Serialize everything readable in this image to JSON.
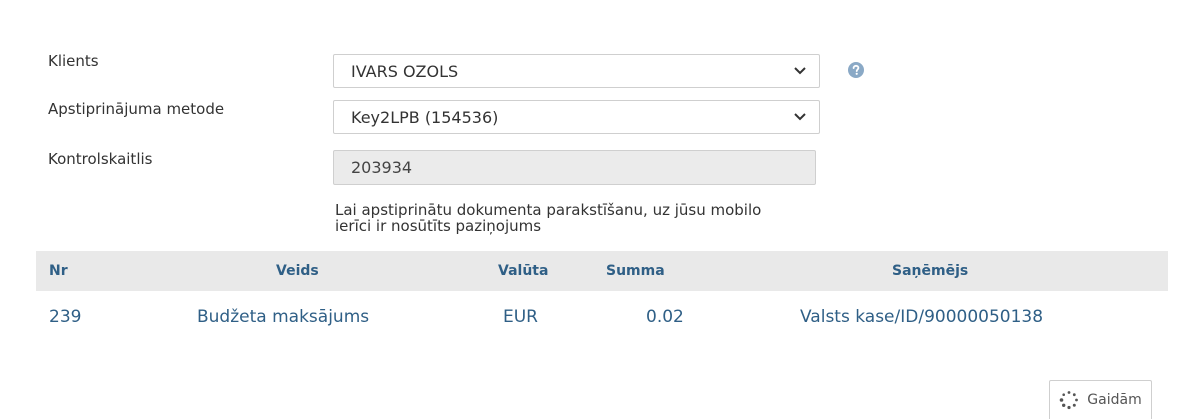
{
  "form": {
    "client_label": "Klients",
    "client_value": "IVARS OZOLS",
    "method_label": "Apstiprinājuma metode",
    "method_value": "Key2LPB (154536)",
    "checksum_label": "Kontrolskaitlis",
    "checksum_value": "203934",
    "notice_line1": "Lai apstiprinātu dokumenta parakstīšanu, uz jūsu mobilo",
    "notice_line2": "ierīci ir nosūtīts paziņojums"
  },
  "table": {
    "headers": {
      "nr": "Nr",
      "type": "Veids",
      "currency": "Valūta",
      "amount": "Summa",
      "recipient": "Saņēmējs"
    },
    "rows": [
      {
        "nr": "239",
        "type": "Budžeta maksājums",
        "currency": "EUR",
        "amount": "0.02",
        "recipient": "Valsts kase/ID/90000050138"
      }
    ]
  },
  "wait_button": {
    "label": "Gaidām"
  },
  "icons": {
    "help": "question-circle-icon",
    "dropdown": "chevron-down-icon",
    "spinner": "spinner-icon"
  },
  "colors": {
    "accent_text": "#2f5f86",
    "help_icon": "#8aa9c6",
    "header_bg": "#e9e9e9",
    "readonly_bg": "#ebebeb"
  }
}
